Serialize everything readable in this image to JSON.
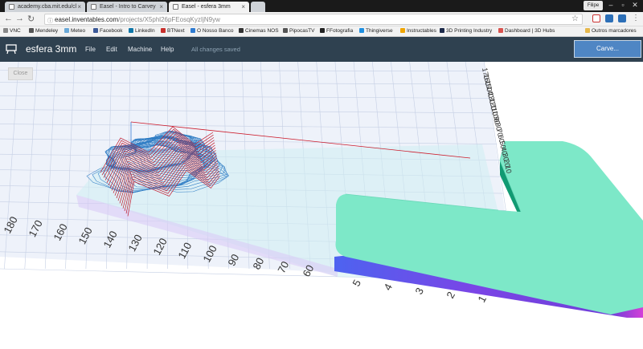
{
  "browser": {
    "tabs": [
      {
        "title": "academy.cba.mit.edu/cl"
      },
      {
        "title": "Easel - Intro to Carvey"
      },
      {
        "title": "Easel - esfera 3mm",
        "active": true
      }
    ],
    "user": "Filipe",
    "url_host": "easel.inventables.com",
    "url_path": "/projects/X5phl26pFEosqKyzIjN9yw",
    "bookmarks": [
      {
        "label": "VNC",
        "color": "#555555"
      },
      {
        "label": "Mendeley",
        "color": "#b22222"
      },
      {
        "label": "Meteo",
        "color": "#6aa9d8"
      },
      {
        "label": "Facebook",
        "color": "#3b5998"
      },
      {
        "label": "LinkedIn",
        "color": "#0e76a8"
      },
      {
        "label": "BTNext",
        "color": "#c9302c"
      },
      {
        "label": "O Nosso Banco",
        "color": "#2e7bd1"
      },
      {
        "label": "Cinemas NOS",
        "color": "#333333"
      },
      {
        "label": "PipocasTV",
        "color": "#555555"
      },
      {
        "label": "FFotografia",
        "color": "#222222"
      },
      {
        "label": "Thingiverse",
        "color": "#1f8fe0"
      },
      {
        "label": "Instructables",
        "color": "#f0a500"
      },
      {
        "label": "3D Printing Industry",
        "color": "#1d2a4a"
      },
      {
        "label": "Dashboard | 3D Hubs",
        "color": "#d9534f"
      }
    ],
    "other_bookmarks": "Outros marcadores"
  },
  "app": {
    "project_title": "esfera 3mm",
    "menu": [
      "File",
      "Edit",
      "Machine",
      "Help"
    ],
    "save_status": "All changes saved",
    "carve_label": "Carve...",
    "close_label": "Close",
    "colors": {
      "appbar": "#2f4150",
      "carve_button": "#4f86c4",
      "toolpath_blue": "#2e7cc4",
      "toolpath_red": "#c2162a",
      "part_top": "#7de8c8",
      "part_side": "#7a45e6"
    }
  },
  "viewport": {
    "left_axis_ticks": [
      "180",
      "170",
      "160",
      "150",
      "140",
      "130",
      "120",
      "110",
      "100",
      "90",
      "80",
      "70",
      "60"
    ],
    "front_axis_ticks": [
      "5",
      "4",
      "3",
      "2",
      "1"
    ],
    "right_axis_ticks": [
      "170",
      "160",
      "150",
      "140",
      "130",
      "120",
      "110",
      "100",
      "90",
      "80",
      "70",
      "60",
      "50",
      "40",
      "30",
      "20",
      "10"
    ]
  }
}
